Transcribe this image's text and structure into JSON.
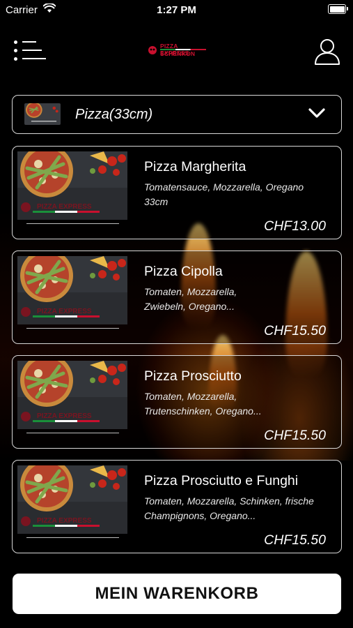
{
  "status_bar": {
    "carrier": "Carrier",
    "time": "1:27 PM"
  },
  "header": {
    "logo_top": "PIZZA EXPRESS",
    "logo_bottom": "SCHENKON"
  },
  "category": {
    "selected": "Pizza(33cm)"
  },
  "menu_items": [
    {
      "name": "Pizza Margherita",
      "desc_line1": "Tomatensauce, Mozzarella, Oregano",
      "desc_line2": "33cm",
      "price": "CHF13.00"
    },
    {
      "name": "Pizza Cipolla",
      "desc_line1": "Tomaten, Mozzarella,",
      "desc_line2": "Zwiebeln, Oregano...",
      "price": "CHF15.50"
    },
    {
      "name": "Pizza Prosciutto",
      "desc_line1": "Tomaten, Mozzarella,",
      "desc_line2": "Trutenschinken, Oregano...",
      "price": "CHF15.50"
    },
    {
      "name": "Pizza Prosciutto e Funghi",
      "desc_line1": "Tomaten, Mozzarella, Schinken, frische",
      "desc_line2": "Champignons, Oregano...",
      "price": "CHF15.50"
    }
  ],
  "cart": {
    "label": "MEIN WARENKORB"
  },
  "icons": {
    "menu": "list-menu-icon",
    "user": "user-icon",
    "chevron": "chevron-down-icon",
    "wifi": "wifi-icon",
    "battery": "battery-icon"
  },
  "colors": {
    "background": "#000000",
    "card_border": "#d8d8d8",
    "cart_button": "#ffffff",
    "brand_red": "#c8102e"
  }
}
